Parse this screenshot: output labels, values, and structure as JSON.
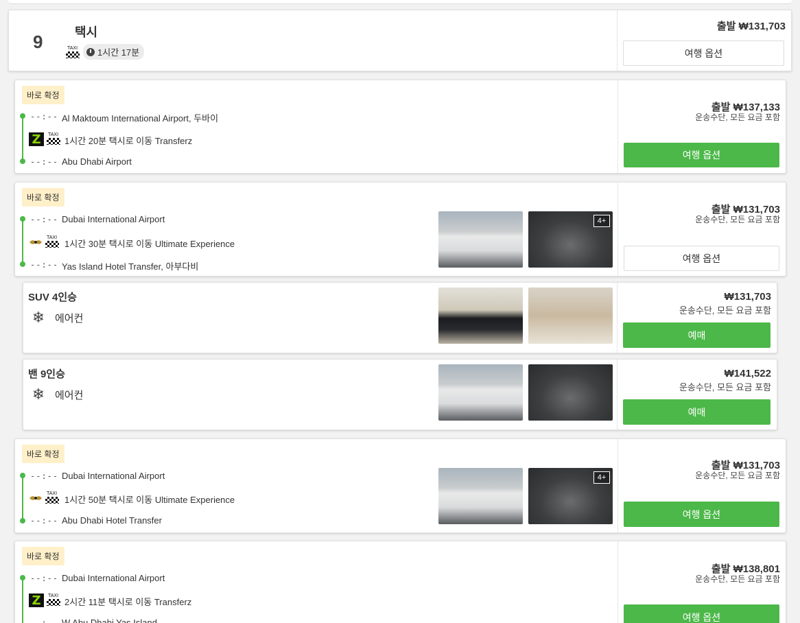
{
  "group": {
    "number": "9",
    "title": "택시",
    "duration": "1시간 17분",
    "price": "출발 ₩131,703",
    "button": "여행 옵션"
  },
  "routes": [
    {
      "badge": "바로 확정",
      "time_from": "--:--",
      "from": "Al Maktoum International Airport, 두바이",
      "duration": "1시간 20분 택시로 이동 Transferz",
      "time_to": "--:--",
      "to": "Abu Dhabi Airport",
      "price": "출발 ₩137,133",
      "includes": "운송수단, 모든 요금 포함",
      "button": "여행 옵션"
    },
    {
      "badge": "바로 확정",
      "time_from": "--:--",
      "from": "Dubai International Airport",
      "duration": "1시간 30분 택시로 이동 Ultimate Experience",
      "time_to": "--:--",
      "to": "Yas Island Hotel Transfer, 아부다비",
      "price": "출발 ₩131,703",
      "includes": "운송수단, 모든 요금 포함",
      "button": "여행 옵션",
      "more_photos": "4+"
    },
    {
      "badge": "바로 확정",
      "time_from": "--:--",
      "from": "Dubai International Airport",
      "duration": "1시간 50분 택시로 이동 Ultimate Experience",
      "time_to": "--:--",
      "to": "Abu Dhabi Hotel Transfer",
      "price": "출발 ₩131,703",
      "includes": "운송수단, 모든 요금 포함",
      "button": "여행 옵션",
      "more_photos": "4+"
    },
    {
      "badge": "바로 확정",
      "time_from": "--:--",
      "from": "Dubai International Airport",
      "duration": "2시간 11분 택시로 이동 Transferz",
      "time_to": "--:--",
      "to": "W Abu Dhabi Yas Island",
      "price": "출발 ₩138,801",
      "includes": "운송수단, 모든 요금 포함",
      "button": "여행 옵션"
    }
  ],
  "vehicles": [
    {
      "name": "SUV 4인승",
      "feature": "에어컨",
      "price": "₩131,703",
      "includes": "운송수단, 모든 요금 포함",
      "button": "예매"
    },
    {
      "name": "밴 9인승",
      "feature": "에어컨",
      "price": "₩141,522",
      "includes": "운송수단, 모든 요금 포함",
      "button": "예매"
    }
  ],
  "taxi_sign": "TAXI",
  "colors": {
    "accent_green": "#4cb849",
    "badge_bg": "#fff0c9"
  },
  "icons": {
    "clock": "clock-icon",
    "taxi": "taxi-icon",
    "snowflake": "snowflake-icon",
    "transferz_logo": "transferz-logo",
    "ultimate_logo": "ultimate-experience-logo"
  }
}
